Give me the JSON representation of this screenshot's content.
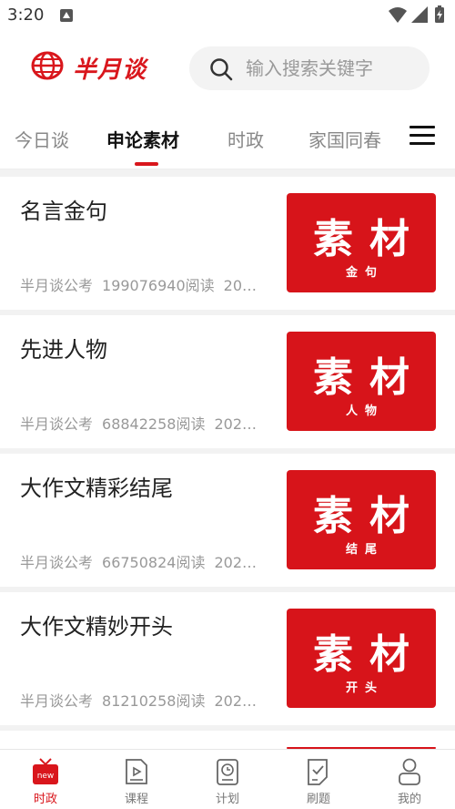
{
  "status_bar": {
    "time": "3:20"
  },
  "header": {
    "logo_text": "半月谈",
    "search_placeholder": "输入搜索关键字"
  },
  "tabs": [
    {
      "label": "今日谈",
      "active": false
    },
    {
      "label": "申论素材",
      "active": true
    },
    {
      "label": "时政",
      "active": false
    },
    {
      "label": "家国同春",
      "active": false
    }
  ],
  "articles": [
    {
      "title": "名言金句",
      "source": "半月谈公考",
      "reads": "199076940阅读",
      "date": "20…",
      "thumb_main": "素材",
      "thumb_sub": "金句"
    },
    {
      "title": "先进人物",
      "source": "半月谈公考",
      "reads": "68842258阅读",
      "date": "202…",
      "thumb_main": "素材",
      "thumb_sub": "人物"
    },
    {
      "title": "大作文精彩结尾",
      "source": "半月谈公考",
      "reads": "66750824阅读",
      "date": "202…",
      "thumb_main": "素材",
      "thumb_sub": "结尾"
    },
    {
      "title": "大作文精妙开头",
      "source": "半月谈公考",
      "reads": "81210258阅读",
      "date": "202…",
      "thumb_main": "素材",
      "thumb_sub": "开头"
    }
  ],
  "bottom_nav": [
    {
      "label": "时政",
      "icon": "news-icon",
      "active": true,
      "badge": "new"
    },
    {
      "label": "课程",
      "icon": "course-play-icon",
      "active": false
    },
    {
      "label": "计划",
      "icon": "plan-clock-icon",
      "active": false
    },
    {
      "label": "刷题",
      "icon": "quiz-check-icon",
      "active": false
    },
    {
      "label": "我的",
      "icon": "user-profile-icon",
      "active": false
    }
  ],
  "colors": {
    "brand_red": "#d9161c",
    "thumb_red": "#d7141a",
    "muted_text": "#999999"
  }
}
